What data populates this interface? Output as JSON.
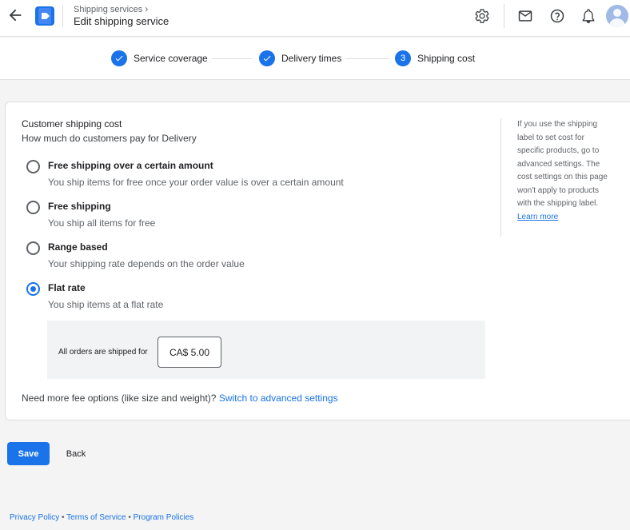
{
  "header": {
    "breadcrumb": "Shipping services",
    "title": "Edit shipping service",
    "icons": [
      "arrow-back-icon",
      "app-logo-icon",
      "gear-icon",
      "mail-icon",
      "help-icon",
      "bell-icon",
      "avatar-icon"
    ]
  },
  "stepper": {
    "steps": [
      {
        "label": "Service coverage",
        "state": "complete"
      },
      {
        "label": "Delivery times",
        "state": "complete"
      },
      {
        "label": "Shipping cost",
        "number": "3",
        "state": "current"
      }
    ]
  },
  "form": {
    "title": "Customer shipping cost",
    "subtitle": "How much do customers pay for Delivery",
    "options": [
      {
        "label": "Free shipping over a certain amount",
        "description": "You ship items for free once your order value is over a certain amount",
        "selected": false
      },
      {
        "label": "Free shipping",
        "description": "You ship all items for free",
        "selected": false
      },
      {
        "label": "Range based",
        "description": "Your shipping rate depends on the order value",
        "selected": false
      },
      {
        "label": "Flat rate",
        "description": "You ship items at a flat rate",
        "selected": true
      }
    ],
    "flat_rate": {
      "label": "All orders are shipped for",
      "value": "CA$ 5.00"
    },
    "more_fee_text": "Need more fee options (like size and weight)?",
    "advanced_link": "Switch to advanced settings"
  },
  "side_note": {
    "text": "If you use the shipping label to set cost for specific products, go to advanced settings. The cost settings on this page won't apply to products with the shipping label.",
    "link": "Learn more"
  },
  "actions": {
    "save": "Save",
    "back": "Back"
  },
  "footer": {
    "privacy": "Privacy Policy",
    "terms": "Terms of Service",
    "policies": "Program Policies",
    "separator": " • "
  },
  "colors": {
    "accent": "#1a73e8",
    "background": "#f4f4f4",
    "text": "#202124",
    "muted": "#5f6368"
  }
}
